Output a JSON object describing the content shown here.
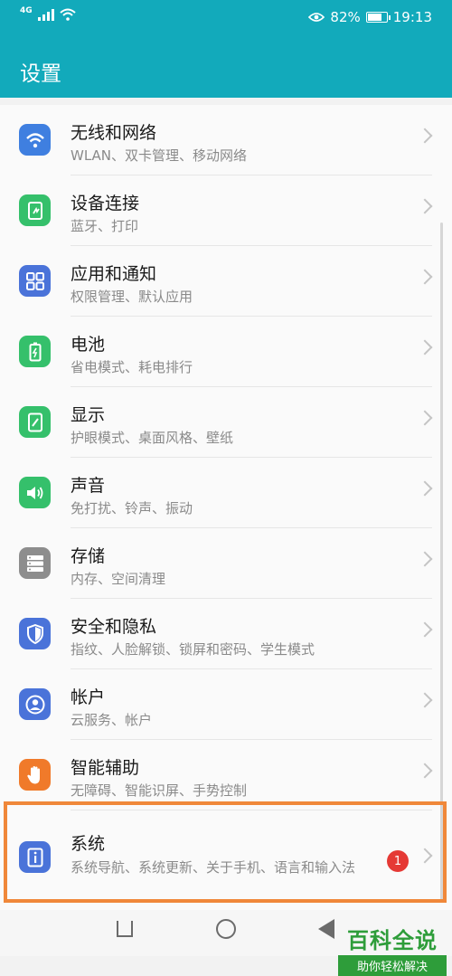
{
  "status_bar": {
    "network": "4G",
    "battery_text": "82%",
    "battery_level": 0.82,
    "time": "19:13"
  },
  "header": {
    "title": "设置"
  },
  "colors": {
    "header_bg": "#12aabb",
    "highlight_border": "#f0883a",
    "badge": "#e53935"
  },
  "settings": {
    "items": [
      {
        "label": "无线和网络",
        "sub": "WLAN、双卡管理、移动网络",
        "icon": "wifi-icon",
        "color": "#3f7fe0"
      },
      {
        "label": "设备连接",
        "sub": "蓝牙、打印",
        "icon": "device-connect-icon",
        "color": "#35c06b"
      },
      {
        "label": "应用和通知",
        "sub": "权限管理、默认应用",
        "icon": "apps-grid-icon",
        "color": "#4a73d9"
      },
      {
        "label": "电池",
        "sub": "省电模式、耗电排行",
        "icon": "battery-icon",
        "color": "#35c06b"
      },
      {
        "label": "显示",
        "sub": "护眼模式、桌面风格、壁纸",
        "icon": "display-icon",
        "color": "#35c06b"
      },
      {
        "label": "声音",
        "sub": "免打扰、铃声、振动",
        "icon": "speaker-icon",
        "color": "#35c06b"
      },
      {
        "label": "存储",
        "sub": "内存、空间清理",
        "icon": "storage-icon",
        "color": "#8d8d8d"
      },
      {
        "label": "安全和隐私",
        "sub": "指纹、人脸解锁、锁屏和密码、学生模式",
        "icon": "shield-icon",
        "color": "#4a73d9"
      },
      {
        "label": "帐户",
        "sub": "云服务、帐户",
        "icon": "account-icon",
        "color": "#4a73d9"
      },
      {
        "label": "智能辅助",
        "sub": "无障碍、智能识屏、手势控制",
        "icon": "hand-icon",
        "color": "#f07a2a"
      },
      {
        "label": "系统",
        "sub": "系统导航、系统更新、关于手机、语言和输入法",
        "icon": "system-info-icon",
        "color": "#4a73d9",
        "badge": "1"
      }
    ]
  },
  "watermark": {
    "title": "百科全说",
    "subtitle": "助你轻松解决"
  }
}
